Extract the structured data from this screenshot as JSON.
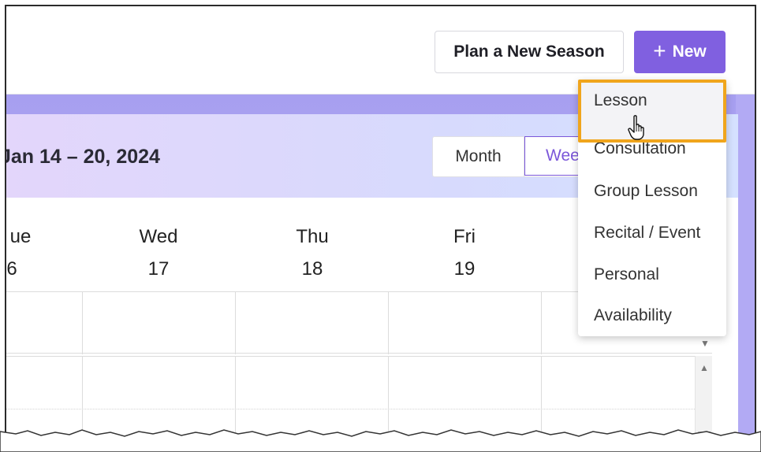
{
  "toolbar": {
    "plan_label": "Plan a New Season",
    "new_plus": "+",
    "new_label": "New"
  },
  "calendar": {
    "date_range": "Jan 14 – 20, 2024",
    "views": {
      "month": "Month",
      "week": "Wee"
    },
    "days": [
      {
        "name": "ue",
        "num": "6"
      },
      {
        "name": "Wed",
        "num": "17"
      },
      {
        "name": "Thu",
        "num": "18"
      },
      {
        "name": "Fri",
        "num": "19"
      }
    ]
  },
  "new_menu": {
    "items": [
      "Lesson",
      "Consultation",
      "Group Lesson",
      "Recital / Event",
      "Personal",
      "Availability"
    ],
    "highlighted_index": 0
  },
  "colors": {
    "accent": "#8060e0",
    "highlight_border": "#f0a51c",
    "band": "#a79ff0"
  },
  "icons": {
    "cursor": "hand-pointer-icon",
    "scroll_up": "triangle-up-icon",
    "scroll_down": "triangle-down-icon"
  }
}
